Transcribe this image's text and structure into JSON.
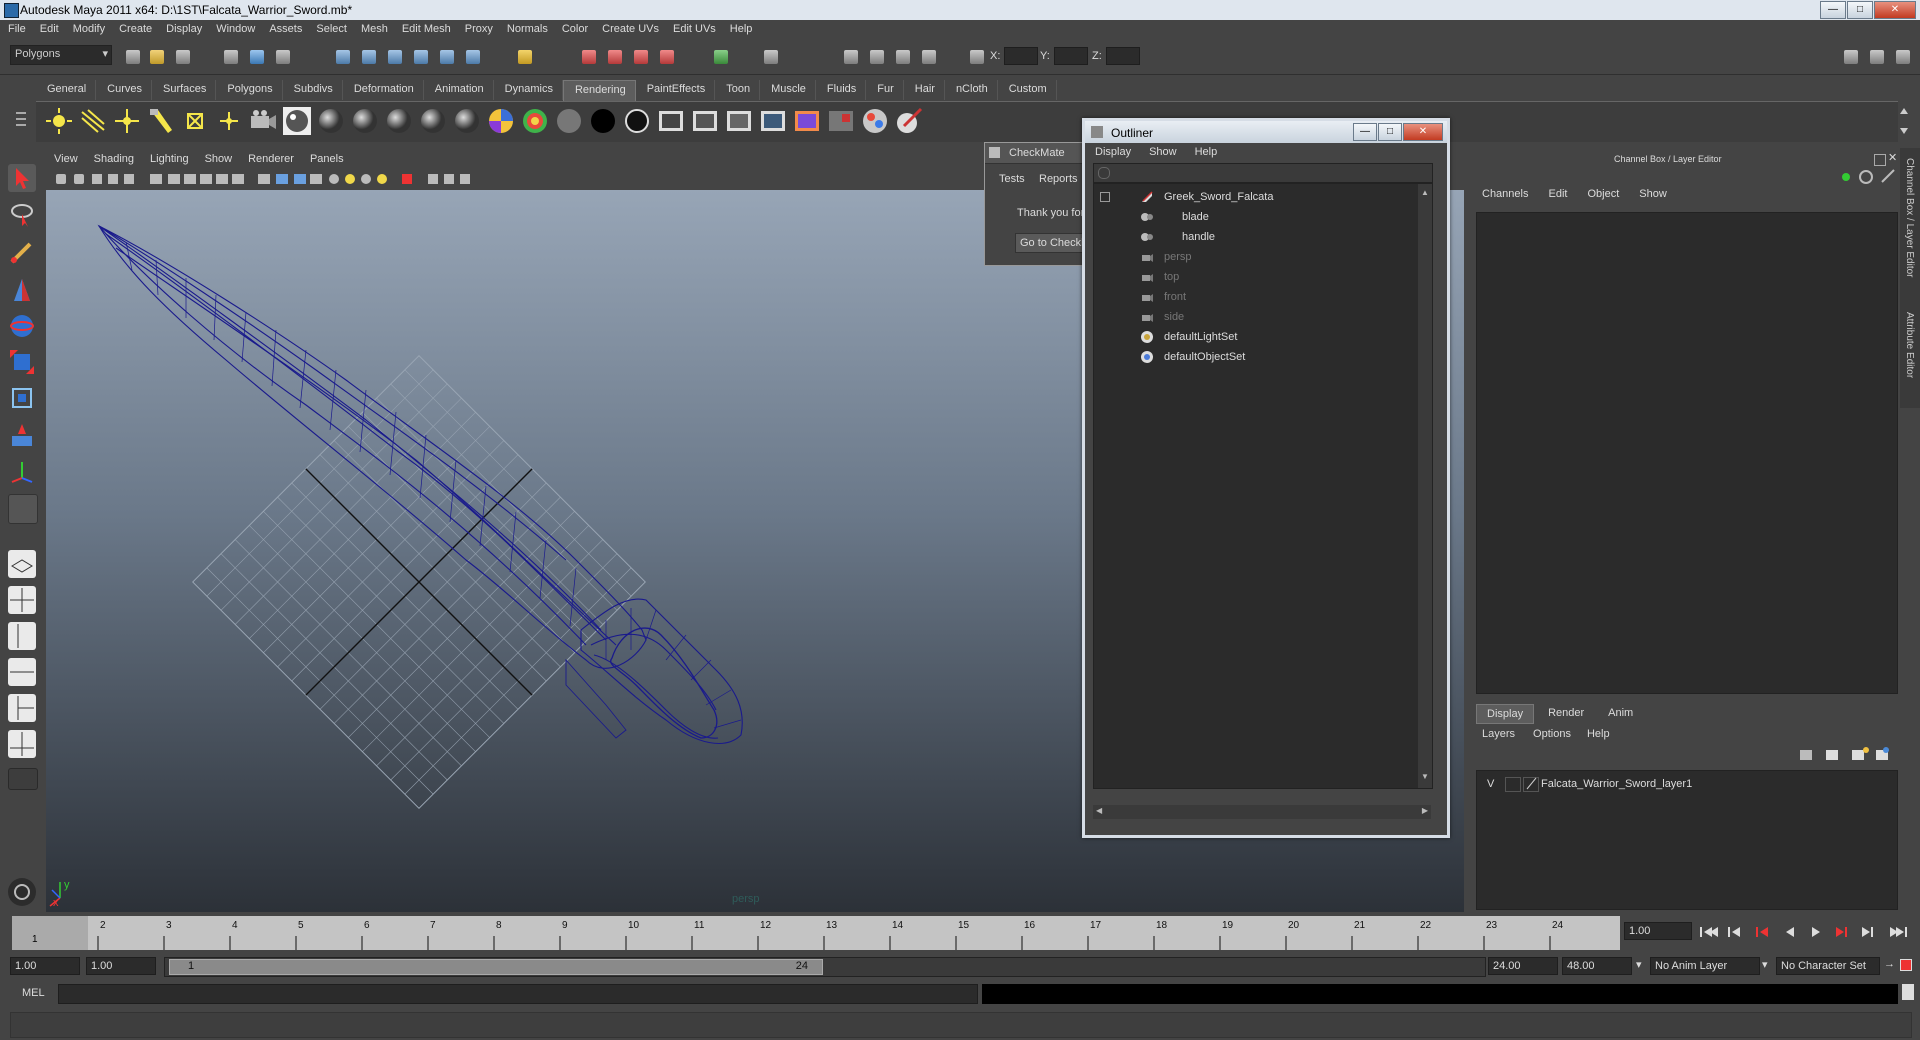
{
  "window": {
    "title": "Autodesk Maya 2011 x64: D:\\1ST\\Falcata_Warrior_Sword.mb*",
    "buttons": [
      "minimize",
      "maximize",
      "close"
    ]
  },
  "menubar": [
    "File",
    "Edit",
    "Modify",
    "Create",
    "Display",
    "Window",
    "Assets",
    "Select",
    "Mesh",
    "Edit Mesh",
    "Proxy",
    "Normals",
    "Color",
    "Create UVs",
    "Edit UVs",
    "Help"
  ],
  "statusline": {
    "menuset": "Polygons",
    "x_label": "X:",
    "y_label": "Y:",
    "z_label": "Z:"
  },
  "shelf": {
    "tabs": [
      "General",
      "Curves",
      "Surfaces",
      "Polygons",
      "Subdivs",
      "Deformation",
      "Animation",
      "Dynamics",
      "Rendering",
      "PaintEffects",
      "Toon",
      "Muscle",
      "Fluids",
      "Fur",
      "Hair",
      "nCloth",
      "Custom"
    ],
    "active_tab": "Rendering"
  },
  "viewport": {
    "menu": [
      "View",
      "Shading",
      "Lighting",
      "Show",
      "Renderer",
      "Panels"
    ],
    "camera_label": "persp",
    "axis_x": "x",
    "axis_y": "y",
    "wire_color": "#1a1a8c"
  },
  "checkmate": {
    "title": "CheckMate",
    "tabs": [
      "Tests",
      "Reports"
    ],
    "body_text": "Thank you for",
    "button": "Go to Checkl"
  },
  "outliner": {
    "title": "Outliner",
    "menu": [
      "Display",
      "Show",
      "Help"
    ],
    "items": [
      {
        "label": "Greek_Sword_Falcata",
        "indent": 0,
        "dim": false,
        "icon": "transform-icon"
      },
      {
        "label": "blade",
        "indent": 1,
        "dim": false,
        "icon": "mesh-icon"
      },
      {
        "label": "handle",
        "indent": 1,
        "dim": false,
        "icon": "mesh-icon"
      },
      {
        "label": "persp",
        "indent": 0,
        "dim": true,
        "icon": "camera-icon"
      },
      {
        "label": "top",
        "indent": 0,
        "dim": true,
        "icon": "camera-icon"
      },
      {
        "label": "front",
        "indent": 0,
        "dim": true,
        "icon": "camera-icon"
      },
      {
        "label": "side",
        "indent": 0,
        "dim": true,
        "icon": "camera-icon"
      },
      {
        "label": "defaultLightSet",
        "indent": 0,
        "dim": false,
        "icon": "set-icon"
      },
      {
        "label": "defaultObjectSet",
        "indent": 0,
        "dim": false,
        "icon": "set-icon"
      }
    ]
  },
  "channelbox": {
    "title": "Channel Box / Layer Editor",
    "menu": [
      "Channels",
      "Edit",
      "Object",
      "Show"
    ],
    "layer_tabs": [
      "Display",
      "Render",
      "Anim"
    ],
    "layer_menu": [
      "Layers",
      "Options",
      "Help"
    ],
    "layers": [
      {
        "visible": "V",
        "name": "Falcata_Warrior_Sword_layer1"
      }
    ],
    "side_tabs": [
      "Channel Box / Layer Editor",
      "Attribute Editor"
    ]
  },
  "timeline": {
    "ticks": [
      "1",
      "2",
      "3",
      "4",
      "5",
      "6",
      "7",
      "8",
      "9",
      "10",
      "11",
      "12",
      "13",
      "14",
      "15",
      "16",
      "17",
      "18",
      "19",
      "20",
      "21",
      "22",
      "23",
      "24"
    ],
    "current_frame": "1",
    "current_time_field": "1.00"
  },
  "range": {
    "start_time": "1.00",
    "playback_start": "1.00",
    "range_start_label": "1",
    "range_end_label": "24",
    "playback_end": "24.00",
    "end_time": "48.00",
    "anim_layer": "No Anim Layer",
    "character_set": "No Character Set"
  },
  "commandline": {
    "label": "MEL"
  }
}
